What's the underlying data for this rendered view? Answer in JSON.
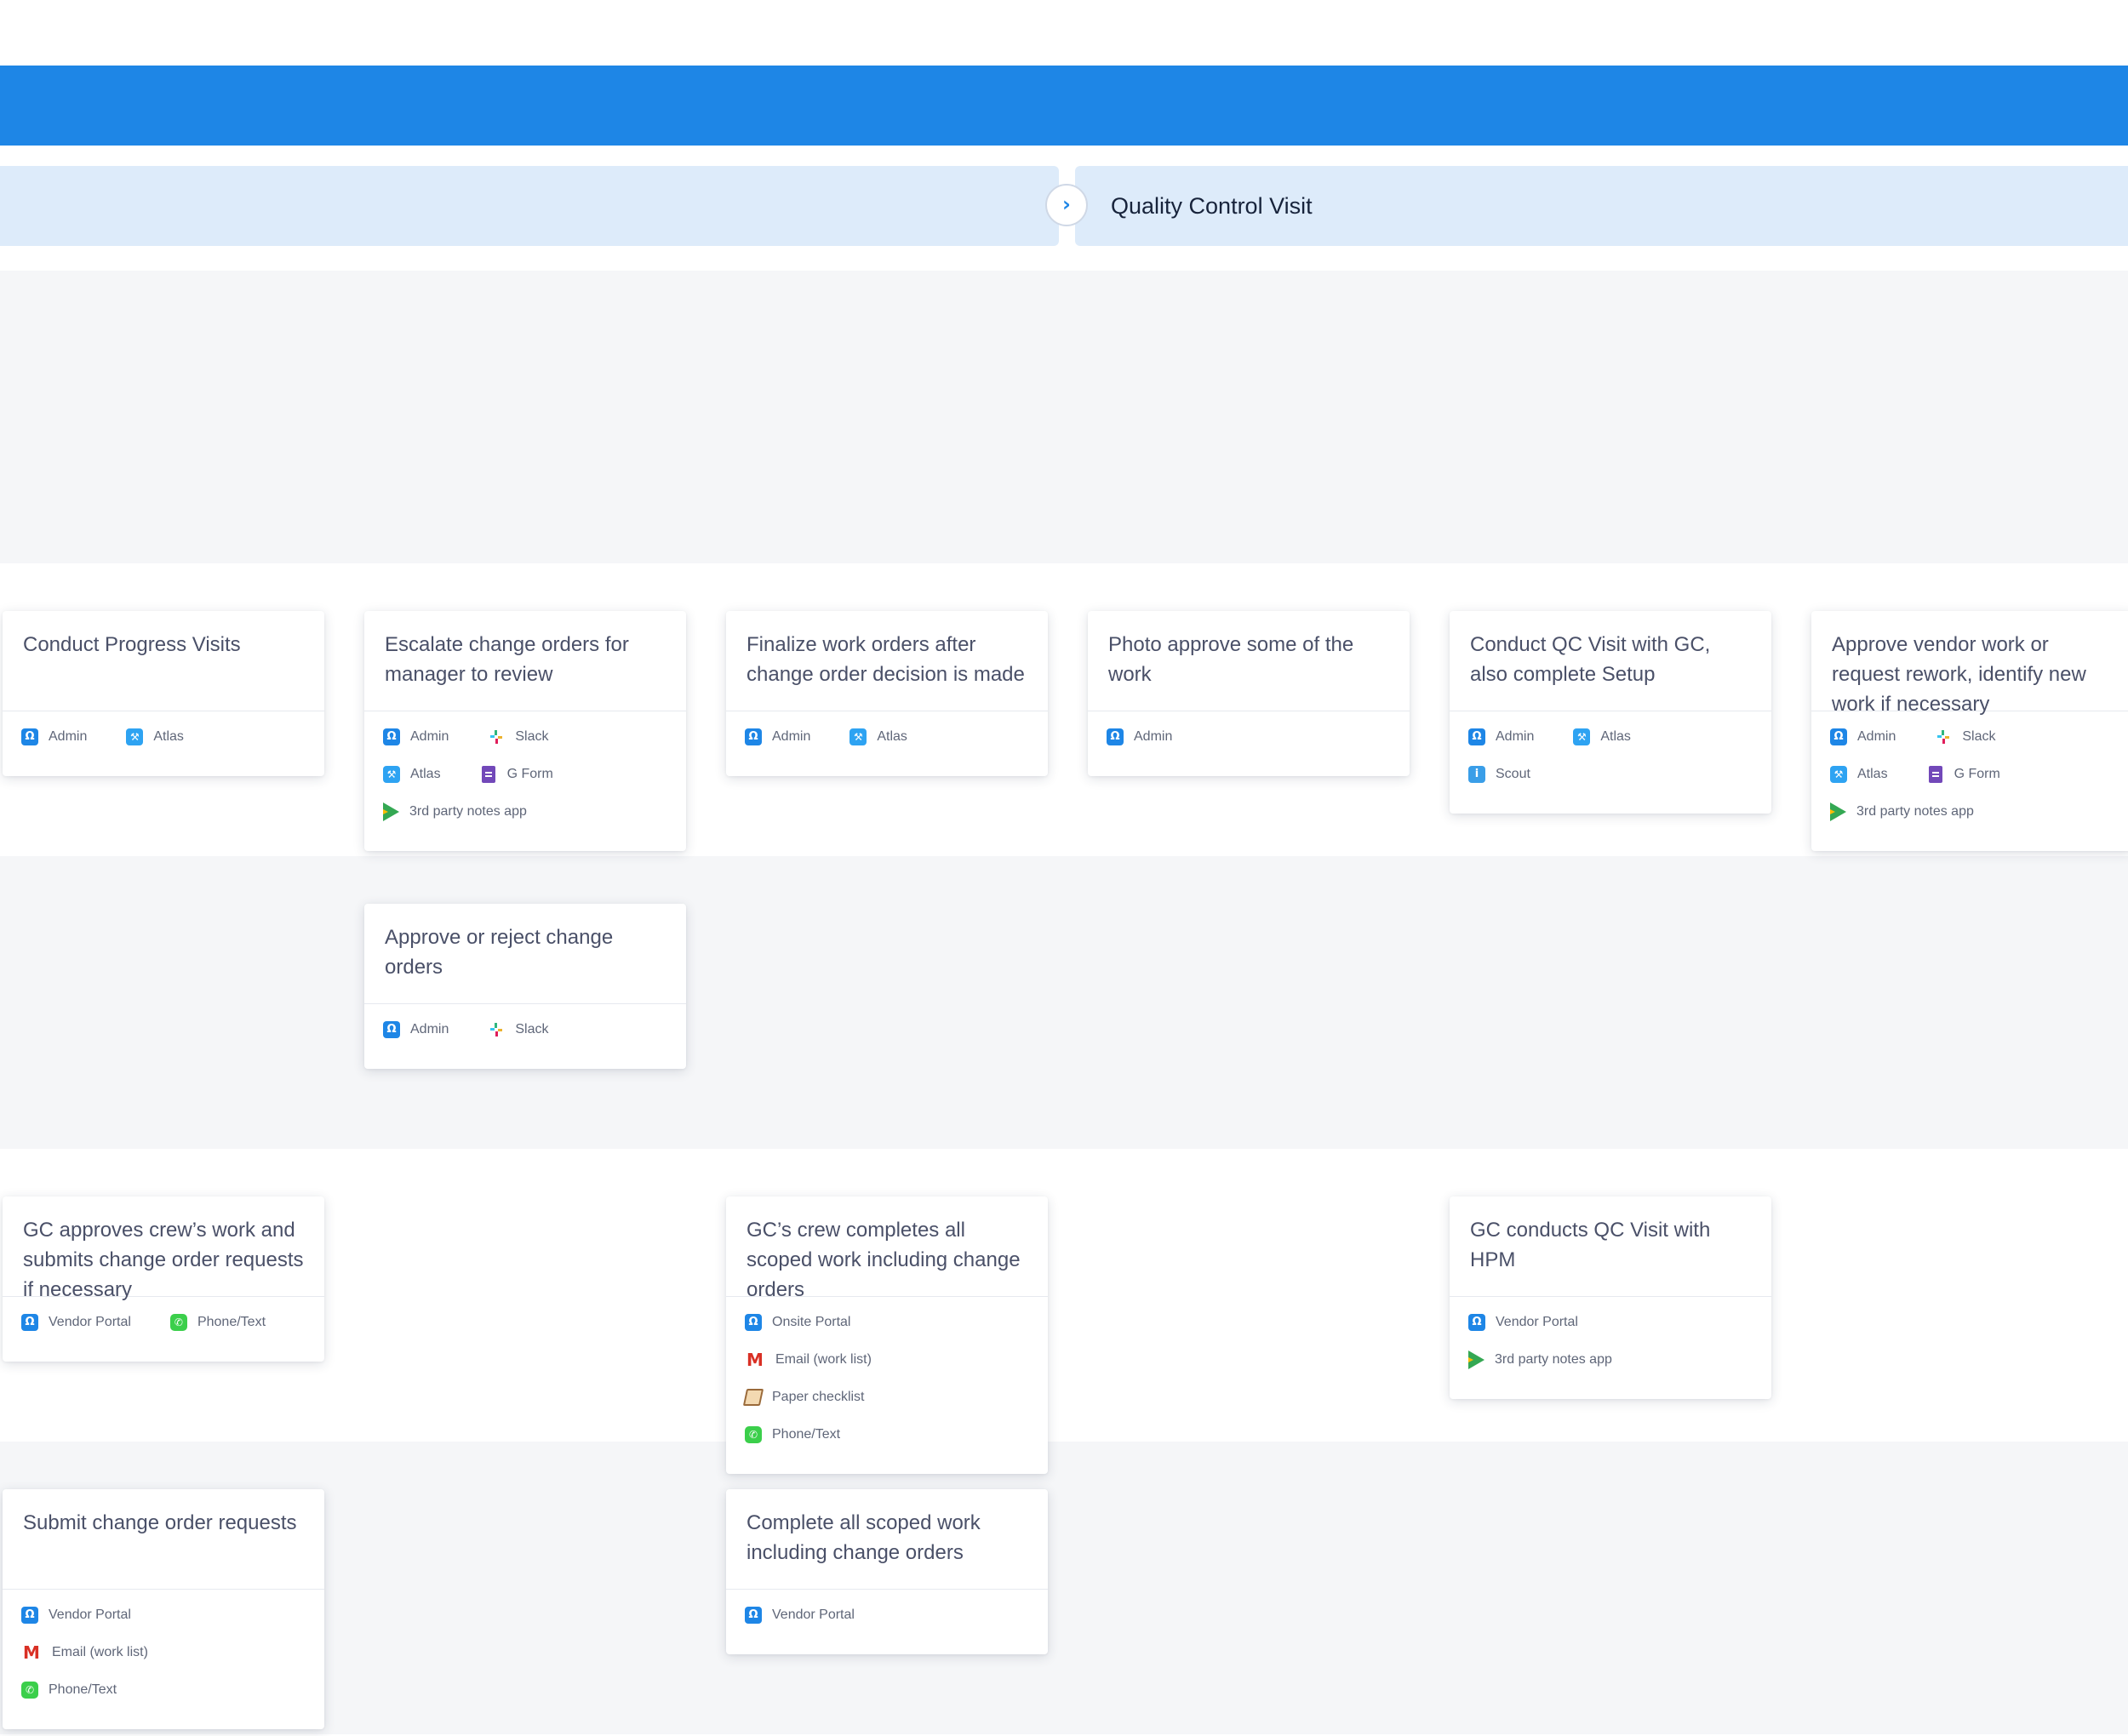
{
  "stage": {
    "title": "Quality Control Visit",
    "toggle_icon": "›"
  },
  "lanes": [
    {
      "bg": "#f5f6f8"
    },
    {
      "bg": "#ffffff"
    },
    {
      "bg": "#f5f6f8"
    },
    {
      "bg": "#ffffff"
    },
    {
      "bg": "#f5f6f8"
    }
  ],
  "tool_icons": {
    "Admin": "admin-icon",
    "Atlas": "atlas-icon",
    "Slack": "slack-icon",
    "Scout": "scout-icon",
    "G Form": "gform-icon",
    "3rd party notes app": "play-store-icon",
    "Vendor Portal": "admin-icon",
    "Onsite Portal": "admin-icon",
    "Phone/Text": "phone-icon",
    "Email (work list)": "gmail-icon",
    "Paper checklist": "paper-icon"
  },
  "colors": {
    "header": "#1e86e6",
    "stage_bg": "#ddebfa",
    "lane_grey": "#f5f6f8",
    "card_text": "#4a5068"
  },
  "cards": [
    {
      "lane": 1,
      "col": 0,
      "title": "Conduct Progress Visits",
      "tools": [
        "Admin",
        "Atlas"
      ]
    },
    {
      "lane": 1,
      "col": 1,
      "title": "Escalate change orders for manager to review",
      "tools": [
        "Admin",
        "Slack",
        "Atlas",
        "G Form",
        "3rd party notes app"
      ]
    },
    {
      "lane": 1,
      "col": 2,
      "title": "Finalize work orders after change order decision is made",
      "tools": [
        "Admin",
        "Atlas"
      ]
    },
    {
      "lane": 1,
      "col": 3,
      "title": "Photo approve some of the work",
      "tools": [
        "Admin"
      ]
    },
    {
      "lane": 1,
      "col": 4,
      "title": "Conduct QC Visit with GC, also complete Setup",
      "tools": [
        "Admin",
        "Atlas",
        "Scout"
      ]
    },
    {
      "lane": 1,
      "col": 5,
      "title": "Approve vendor work or request rework, identify new work if necessary",
      "tools": [
        "Admin",
        "Slack",
        "Atlas",
        "G Form",
        "3rd party notes app"
      ]
    },
    {
      "lane": 2,
      "col": 1,
      "title": "Approve or reject change orders",
      "tools": [
        "Admin",
        "Slack"
      ]
    },
    {
      "lane": 3,
      "col": 0,
      "title": "GC approves crew’s work and submits change order requests if necessary",
      "tools": [
        "Vendor Portal",
        "Phone/Text"
      ]
    },
    {
      "lane": 3,
      "col": 2,
      "title": "GC’s crew completes all scoped work including change orders",
      "tools": [
        "Onsite Portal",
        "Email (work list)",
        "Paper checklist",
        "Phone/Text"
      ]
    },
    {
      "lane": 3,
      "col": 4,
      "title": "GC conducts QC Visit with HPM",
      "tools": [
        "Vendor Portal",
        "3rd party notes app"
      ]
    },
    {
      "lane": 4,
      "col": 0,
      "title": "Submit change order requests",
      "tools": [
        "Vendor Portal",
        "Email (work list)",
        "Phone/Text"
      ]
    },
    {
      "lane": 4,
      "col": 2,
      "title": "Complete all scoped work including change orders",
      "tools": [
        "Vendor Portal"
      ]
    }
  ]
}
